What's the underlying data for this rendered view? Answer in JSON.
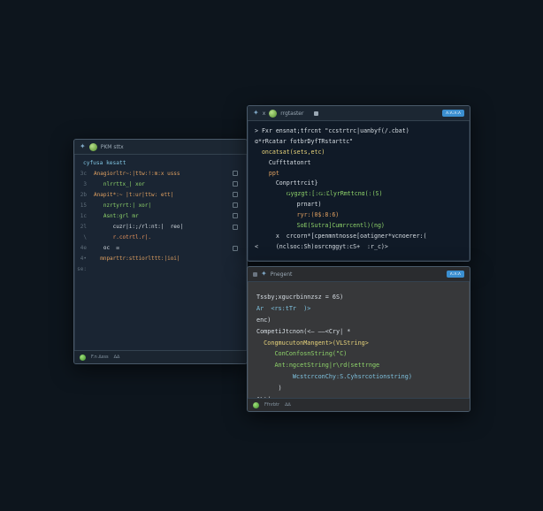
{
  "win1": {
    "title": "PKM  sttx",
    "status_left": "F.n ∆sss",
    "status_right": "∆∆",
    "header": "cyfusa kesatt",
    "lines": [
      {
        "num": "3c",
        "text": "Anagiorltr~:|ttw:!:m:x usss"
      },
      {
        "num": "3",
        "text": "   nlrrttx_| xor"
      },
      {
        "num": "2b",
        "text": "Anapit*:~ |t:ur|ttw: ett|"
      },
      {
        "num": "15",
        "text": "   nzrtyrrt:| xor|"
      },
      {
        "num": "1c",
        "text": "   Asnt:grl mr"
      },
      {
        "num": "2l",
        "text": "      cuzr|i:;/rl:nt:|  reo|"
      },
      {
        "num": "\\",
        "text": "      r.cotrtl.r|."
      },
      {
        "num": "4e",
        "text": "   oc  ☒"
      },
      {
        "num": "4•",
        "text": "  mnparttr:sttiorlttt:|ioi|"
      },
      {
        "num": "se:",
        "text": ""
      }
    ]
  },
  "win2": {
    "title": "rrgtaster",
    "badge": "ʌ:ʌ:ʌ:ʌ",
    "lines": [
      "> Fxr ensnat;tfrcnt \"ccstrtrc|uanbyf(/.cbat)",
      "ɑ*rRcatar fotbrDyfTRstarttc\"",
      "  oncatsat(sets,etc)",
      "    Cuffttatonrt",
      "    ppt",
      "      Conprttrcit}",
      "         Ǥygzgt:[:Ǥ:ĽlyrRmttcnɑ(:(S)",
      "            prnart)",
      "            ryr:(0$:8:6)",
      "            SoE(Sutra]Cumrrcentl)(ng)",
      "      x  crcorn*[cpenmntnosse[oatigner*vcnoerer:(",
      "<     (nclsoc:Sh)osrcnggyt:cS+  :r_c)>"
    ]
  },
  "win3": {
    "title": "Pnegent",
    "badge": "ʌ:ʌ:ʌ",
    "status_left": "Ffnrbtr",
    "status_right": "∆∆",
    "lines": [
      "Tssby;xgucrbinnzsz = 6S)",
      "Ar  <rs:tTr  )>",
      "enc)",
      "CompetiJtcnon(<— ——<Cry| *",
      "  CongmucutonMangent>(VLString>",
      "     ConConfosnString(\"C)",
      "     Ant:ngcetString|r\\rd(settrnge",
      "          WcstcrconChy:S.Cyhsrcotionstring)",
      "      )",
      "ALt(:"
    ]
  }
}
